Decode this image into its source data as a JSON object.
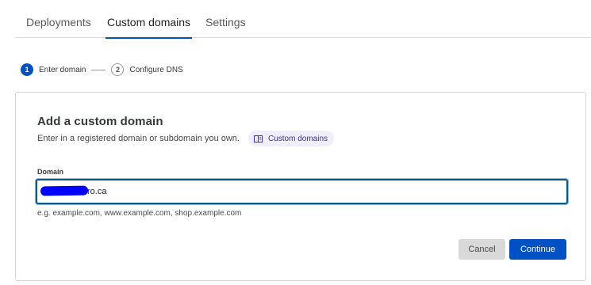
{
  "tabs": [
    {
      "label": "Deployments"
    },
    {
      "label": "Custom domains",
      "active": true
    },
    {
      "label": "Settings"
    }
  ],
  "steps": [
    {
      "number": "1",
      "label": "Enter domain",
      "active": true
    },
    {
      "number": "2",
      "label": "Configure DNS",
      "active": false
    }
  ],
  "card": {
    "title": "Add a custom domain",
    "subtitle": "Enter in a registered domain or subdomain you own.",
    "doc_link": "Custom domains"
  },
  "field": {
    "label": "Domain",
    "value": "ro.ca",
    "hint": "e.g. example.com, www.example.com, shop.example.com"
  },
  "buttons": {
    "cancel": "Cancel",
    "continue": "Continue"
  },
  "colors": {
    "accent": "#0051c3",
    "chip_bg": "#f0eefc",
    "redaction": "#0000ff"
  }
}
